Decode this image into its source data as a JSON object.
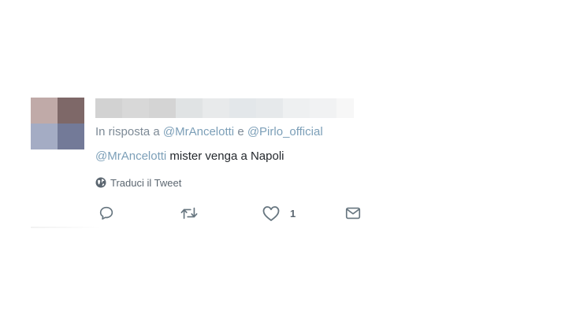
{
  "tweet": {
    "reply_prefix": "In risposta a",
    "reply_to_1": "@MrAncelotti",
    "reply_joiner": "e",
    "reply_to_2": "@Pirlo_official",
    "text_mention": "@MrAncelotti",
    "text_body": "mister venga a Napoli",
    "translate_label": "Traduci il Tweet",
    "like_count": "1"
  },
  "icons": {
    "reply": "reply-icon",
    "retweet": "retweet-icon",
    "like": "heart-icon",
    "dm": "envelope-icon",
    "translate": "globe-icon"
  },
  "colors": {
    "mention": "#7c9fb8",
    "meta_text": "#7d8a96",
    "body_text": "#24282d",
    "icon": "#66757f"
  }
}
